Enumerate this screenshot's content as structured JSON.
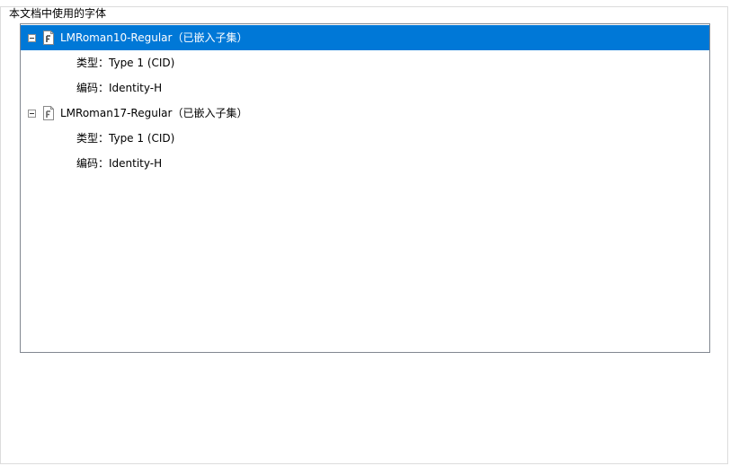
{
  "group_title": "本文档中使用的字体",
  "fonts": [
    {
      "name": "LMRoman10-Regular（已嵌入子集）",
      "selected": true,
      "expanded": true,
      "icon": "font-file-icon",
      "props": [
        "类型：Type 1 (CID)",
        "编码：Identity-H"
      ]
    },
    {
      "name": "LMRoman17-Regular（已嵌入子集）",
      "selected": false,
      "expanded": true,
      "icon": "font-file-icon",
      "props": [
        "类型：Type 1 (CID)",
        "编码：Identity-H"
      ]
    }
  ],
  "colors": {
    "selection": "#0078d7",
    "border": "#828790"
  }
}
